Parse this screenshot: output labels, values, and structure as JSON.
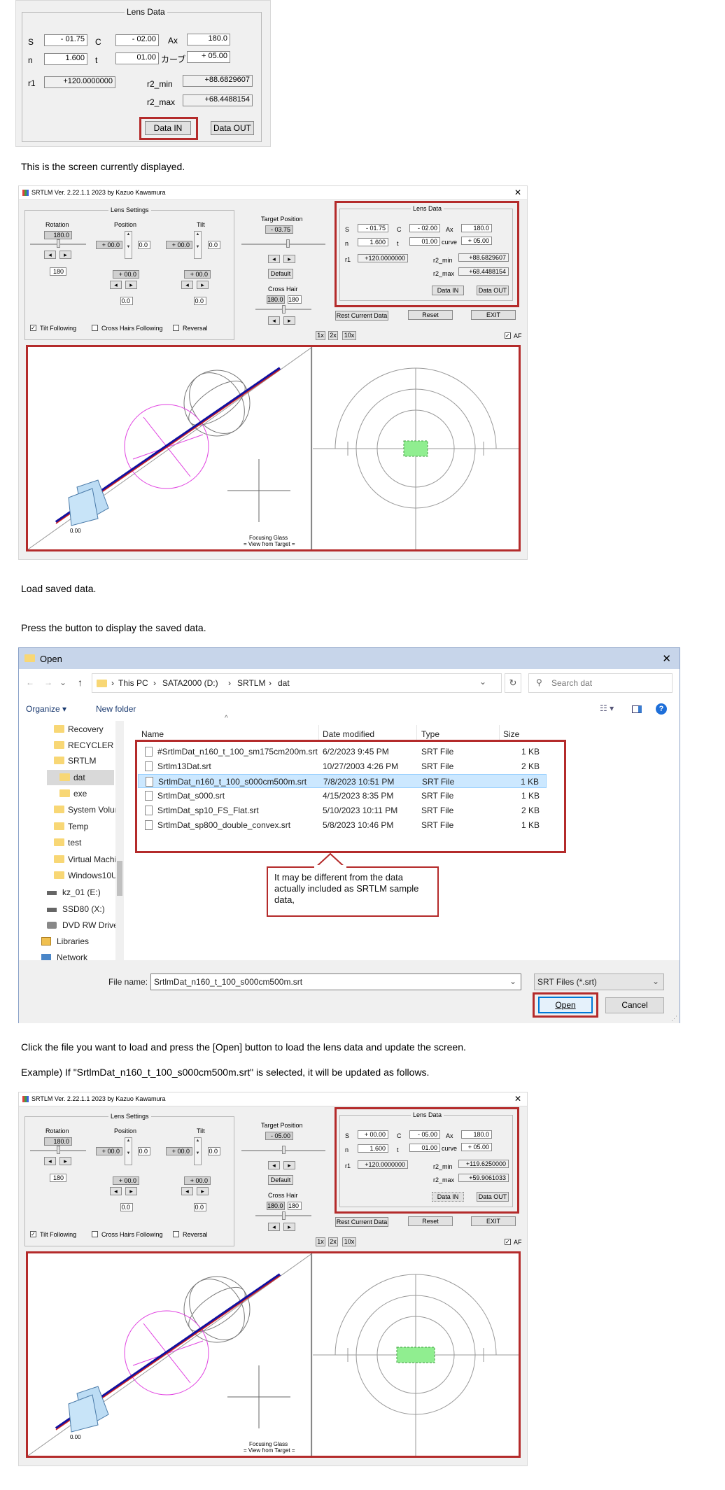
{
  "texts": {
    "t1": "This is the screen currently displayed.",
    "t2": "Load saved data.",
    "t3": "Press the button to display the saved data.",
    "t4": "Click the file you want to load and press the [Open] button to load the lens data and update the screen.",
    "t5": "Example) If \"SrtlmDat_n160_t_100_s000cm500m.srt\" is selected, it will be updated as follows."
  },
  "top_lens": {
    "title": "Lens Data",
    "s_label": "S",
    "s": "- 01.75",
    "c_label": "C",
    "c": "- 02.00",
    "ax_label": "Ax",
    "ax": "180.0",
    "n_label": "n",
    "n": "1.600",
    "t_label": "t",
    "t": "01.00",
    "curve_label": "カーブ",
    "curve": "+ 05.00",
    "r1_label": "r1",
    "r1": "+120.0000000",
    "r2min_label": "r2_min",
    "r2min": "+88.6829607",
    "r2max_label": "r2_max",
    "r2max": "+68.4488154",
    "data_in": "Data IN",
    "data_out": "Data OUT"
  },
  "app1": {
    "title": "SRTLM Ver. 2.22.1.1 2023 by Kazuo Kawamura",
    "close": "✕",
    "lens_settings": "Lens Settings",
    "rotation": "Rotation",
    "position": "Position",
    "tilt": "Tilt",
    "rot_val": "180.0",
    "rot_val2": "180",
    "pos_val": "+ 00.0",
    "pos_val_b": "0.0",
    "pos_val2": "+ 00.0",
    "pos_val2_b": "0.0",
    "tilt_val": "+ 00.0",
    "tilt_val_b": "0.0",
    "tilt_val2": "+ 00.0",
    "tilt_val2_b": "0.0",
    "tilt_following": "Tilt Following",
    "cross_hairs_following": "Cross Hairs Following",
    "reversal": "Reversal",
    "target_position": "Target Position",
    "target_val": "- 03.75",
    "default": "Default",
    "cross_hair": "Cross Hair",
    "ch_val": "180.0",
    "ch_val2": "180",
    "lens_data": "Lens Data",
    "s_label": "S",
    "s": "- 01.75",
    "c_label": "C",
    "c": "- 02.00",
    "ax_label": "Ax",
    "ax": "180.0",
    "n_label": "n",
    "n": "1.600",
    "t_label": "t",
    "t": "01.00",
    "curve_label": "curve",
    "curve": "+ 05.00",
    "r1_label": "r1",
    "r1": "+120.0000000",
    "r2min_label": "r2_min",
    "r2min": "+88.6829607",
    "r2max_label": "r2_max",
    "r2max": "+68.4488154",
    "data_in": "Data IN",
    "data_out": "Data OUT",
    "rest": "Rest Current Data",
    "reset": "Reset",
    "exit": "EXIT",
    "z1": "1x",
    "z2": "2x",
    "z10": "10x",
    "af": "AF",
    "origin": "0.00",
    "focus1": "Focusing Glass",
    "focus2": "= View from Target ="
  },
  "dialog": {
    "title": "Open",
    "close": "✕",
    "breadcrumb": [
      "This PC",
      "SATA2000 (D:)",
      "SRTLM",
      "dat"
    ],
    "search_placeholder": "Search dat",
    "organize": "Organize ▾",
    "new_folder": "New folder",
    "sidebar": [
      "Recovery",
      "RECYCLER",
      "SRTLM",
      "dat",
      "exe",
      "System Volun",
      "Temp",
      "test",
      "Virtual Machi",
      "Windows10U",
      "kz_01 (E:)",
      "SSD80 (X:)",
      "DVD RW Drive",
      "Libraries",
      "Network"
    ],
    "columns": [
      "Name",
      "Date modified",
      "Type",
      "Size"
    ],
    "files": [
      {
        "name": "#SrtlmDat_n160_t_100_sm175cm200m.srt",
        "date": "6/2/2023 9:45 PM",
        "type": "SRT File",
        "size": "1 KB"
      },
      {
        "name": "Srtlm13Dat.srt",
        "date": "10/27/2003 4:26 PM",
        "type": "SRT File",
        "size": "2 KB"
      },
      {
        "name": "SrtlmDat_n160_t_100_s000cm500m.srt",
        "date": "7/8/2023 10:51 PM",
        "type": "SRT File",
        "size": "1 KB"
      },
      {
        "name": "SrtlmDat_s000.srt",
        "date": "4/15/2023 8:35 PM",
        "type": "SRT File",
        "size": "1 KB"
      },
      {
        "name": "SrtlmDat_sp10_FS_Flat.srt",
        "date": "5/10/2023 10:11 PM",
        "type": "SRT File",
        "size": "2 KB"
      },
      {
        "name": "SrtlmDat_sp800_double_convex.srt",
        "date": "5/8/2023 10:46 PM",
        "type": "SRT File",
        "size": "1 KB"
      }
    ],
    "callout": "It may be different from the data actually included as SRTLM sample data,",
    "filename_label": "File name:",
    "filename": "SrtlmDat_n160_t_100_s000cm500m.srt",
    "filetype": "SRT Files (*.srt)",
    "open": "Open",
    "cancel": "Cancel"
  },
  "app2": {
    "title": "SRTLM Ver. 2.22.1.1 2023 by Kazuo Kawamura",
    "close": "✕",
    "lens_settings": "Lens Settings",
    "rotation": "Rotation",
    "position": "Position",
    "tilt": "Tilt",
    "rot_val": "180.0",
    "rot_val2": "180",
    "pos_val": "+ 00.0",
    "pos_val_b": "0.0",
    "pos_val2": "+ 00.0",
    "pos_val2_b": "0.0",
    "tilt_val": "+ 00.0",
    "tilt_val_b": "0.0",
    "tilt_val2": "+ 00.0",
    "tilt_val2_b": "0.0",
    "tilt_following": "Tilt Following",
    "cross_hairs_following": "Cross Hairs Following",
    "reversal": "Reversal",
    "target_position": "Target Position",
    "target_val": "- 05.00",
    "default": "Default",
    "cross_hair": "Cross Hair",
    "ch_val": "180.0",
    "ch_val2": "180",
    "lens_data": "Lens Data",
    "s_label": "S",
    "s": "+ 00.00",
    "c_label": "C",
    "c": "- 05.00",
    "ax_label": "Ax",
    "ax": "180.0",
    "n_label": "n",
    "n": "1.600",
    "t_label": "t",
    "t": "01.00",
    "curve_label": "curve",
    "curve": "+ 05.00",
    "r1_label": "r1",
    "r1": "+120.0000000",
    "r2min_label": "r2_min",
    "r2min": "+119.6250000",
    "r2max_label": "r2_max",
    "r2max": "+59.9061033",
    "data_in": "Data IN",
    "data_out": "Data OUT",
    "rest": "Rest Current Data",
    "reset": "Reset",
    "exit": "EXIT",
    "z1": "1x",
    "z2": "2x",
    "z10": "10x",
    "af": "AF",
    "origin": "0.00",
    "focus1": "Focusing Glass",
    "focus2": "= View from Target ="
  },
  "colors": {
    "highlight": "#b42b2b",
    "titlebar": "#c7d5ea",
    "selected": "#cce8ff"
  }
}
